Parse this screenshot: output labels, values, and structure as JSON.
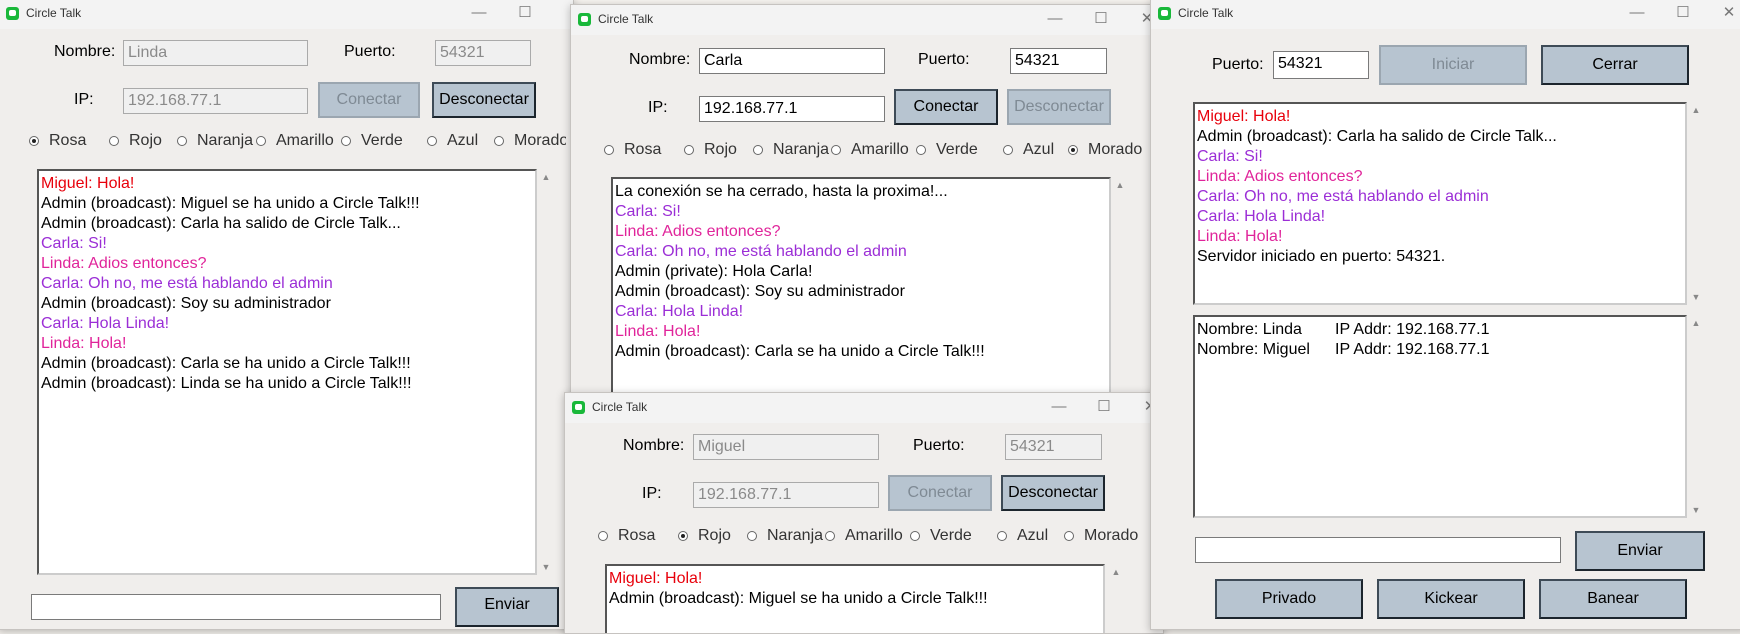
{
  "colors": {
    "red": "#e8000b",
    "purple": "#9b2ed6",
    "pink": "#e0249a",
    "black": "#000000",
    "window_bg": "#f0eeec",
    "button_bg": "#b7c4d0"
  },
  "icons": {
    "app": "chat-bubble-green-icon",
    "minimize": "minimize-icon",
    "maximize": "maximize-icon",
    "close": "close-icon"
  },
  "win_linda": {
    "title": "Circle Talk",
    "nombre_label": "Nombre:",
    "nombre_value": "Linda",
    "puerto_label": "Puerto:",
    "puerto_value": "54321",
    "ip_label": "IP:",
    "ip_value": "192.168.77.1",
    "conectar": "Conectar",
    "desconectar": "Desconectar",
    "radios": [
      "Rosa",
      "Rojo",
      "Naranja",
      "Amarillo",
      "Verde",
      "Azul",
      "Morado"
    ],
    "selected": "Rosa",
    "messages": [
      {
        "text": "Miguel: Hola!",
        "color": "#e8000b"
      },
      {
        "text": "Admin (broadcast): Miguel se ha unido a Circle Talk!!!",
        "color": "#000000"
      },
      {
        "text": "Admin (broadcast): Carla ha salido de Circle Talk...",
        "color": "#000000"
      },
      {
        "text": "Carla: Si!",
        "color": "#9b2ed6"
      },
      {
        "text": "Linda: Adios entonces?",
        "color": "#e0249a"
      },
      {
        "text": "Carla: Oh no, me está hablando el admin",
        "color": "#9b2ed6"
      },
      {
        "text": "Admin (broadcast): Soy su administrador",
        "color": "#000000"
      },
      {
        "text": "Carla: Hola Linda!",
        "color": "#9b2ed6"
      },
      {
        "text": "Linda: Hola!",
        "color": "#e0249a"
      },
      {
        "text": "Admin (broadcast): Carla se ha unido a Circle Talk!!!",
        "color": "#000000"
      },
      {
        "text": "Admin (broadcast): Linda se ha unido a Circle Talk!!!",
        "color": "#000000"
      }
    ],
    "input_value": "",
    "enviar": "Enviar"
  },
  "win_carla": {
    "title": "Circle Talk",
    "nombre_label": "Nombre:",
    "nombre_value": "Carla",
    "puerto_label": "Puerto:",
    "puerto_value": "54321",
    "ip_label": "IP:",
    "ip_value": "192.168.77.1",
    "conectar": "Conectar",
    "desconectar": "Desconectar",
    "radios": [
      "Rosa",
      "Rojo",
      "Naranja",
      "Amarillo",
      "Verde",
      "Azul",
      "Morado"
    ],
    "selected": "Morado",
    "messages": [
      {
        "text": "La conexión se ha cerrado, hasta la proxima!...",
        "color": "#000000"
      },
      {
        "text": "Carla: Si!",
        "color": "#9b2ed6"
      },
      {
        "text": "Linda: Adios entonces?",
        "color": "#e0249a"
      },
      {
        "text": "Carla: Oh no, me está hablando el admin",
        "color": "#9b2ed6"
      },
      {
        "text": "Admin (private): Hola Carla!",
        "color": "#000000"
      },
      {
        "text": "Admin (broadcast): Soy su administrador",
        "color": "#000000"
      },
      {
        "text": "Carla: Hola Linda!",
        "color": "#9b2ed6"
      },
      {
        "text": "Linda: Hola!",
        "color": "#e0249a"
      },
      {
        "text": "Admin (broadcast): Carla se ha unido a Circle Talk!!!",
        "color": "#000000"
      }
    ]
  },
  "win_miguel": {
    "title": "Circle Talk",
    "nombre_label": "Nombre:",
    "nombre_value": "Miguel",
    "puerto_label": "Puerto:",
    "puerto_value": "54321",
    "ip_label": "IP:",
    "ip_value": "192.168.77.1",
    "conectar": "Conectar",
    "desconectar": "Desconectar",
    "radios": [
      "Rosa",
      "Rojo",
      "Naranja",
      "Amarillo",
      "Verde",
      "Azul",
      "Morado"
    ],
    "selected": "Rojo",
    "messages": [
      {
        "text": "Miguel: Hola!",
        "color": "#e8000b"
      },
      {
        "text": "Admin (broadcast): Miguel se ha unido a Circle Talk!!!",
        "color": "#000000"
      }
    ]
  },
  "win_server": {
    "title": "Circle Talk",
    "puerto_label": "Puerto:",
    "puerto_value": "54321",
    "iniciar": "Iniciar",
    "cerrar": "Cerrar",
    "messages": [
      {
        "text": "Miguel: Hola!",
        "color": "#e8000b"
      },
      {
        "text": "Admin (broadcast): Carla ha salido de Circle Talk...",
        "color": "#000000"
      },
      {
        "text": "Carla: Si!",
        "color": "#9b2ed6"
      },
      {
        "text": "Linda: Adios entonces?",
        "color": "#e0249a"
      },
      {
        "text": "Carla: Oh no, me está hablando el admin",
        "color": "#9b2ed6"
      },
      {
        "text": "Carla: Hola Linda!",
        "color": "#9b2ed6"
      },
      {
        "text": "Linda: Hola!",
        "color": "#e0249a"
      },
      {
        "text": "Servidor iniciado en puerto: 54321.",
        "color": "#000000"
      }
    ],
    "clients": [
      {
        "nombre": "Nombre: Linda",
        "ip": "IP Addr: 192.168.77.1"
      },
      {
        "nombre": "Nombre: Miguel",
        "ip": "IP Addr: 192.168.77.1"
      }
    ],
    "input_value": "",
    "enviar": "Enviar",
    "privado": "Privado",
    "kickear": "Kickear",
    "banear": "Banear"
  }
}
